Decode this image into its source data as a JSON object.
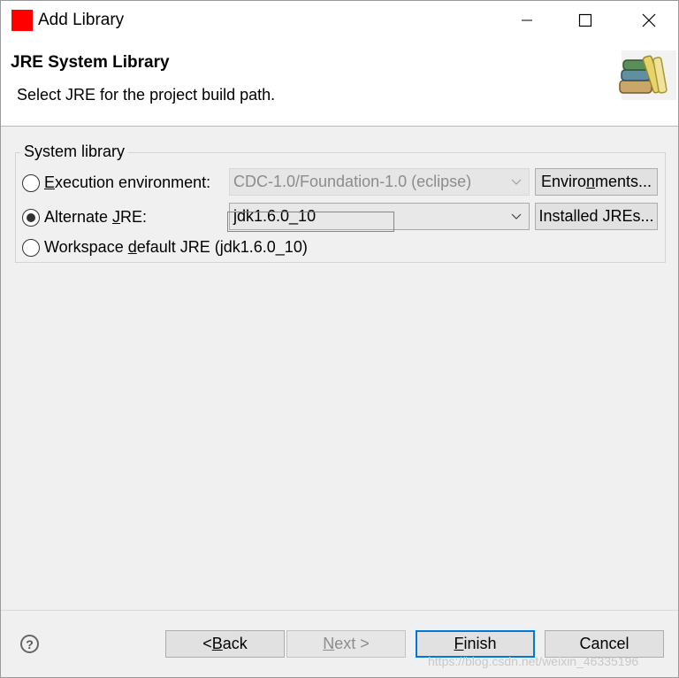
{
  "window": {
    "title": "Add Library"
  },
  "banner": {
    "title": "JRE System Library",
    "description": "Select JRE for the project build path.",
    "icon": "library-books-icon"
  },
  "group": {
    "label": "System library",
    "options": [
      {
        "label_before": "",
        "label_mnemonic": "E",
        "label_after": "xecution environment:",
        "checked": false,
        "combo_value": "CDC-1.0/Foundation-1.0 (eclipse)",
        "combo_enabled": false,
        "button_label_before": "Enviro",
        "button_label_mnemonic": "n",
        "button_label_after": "ments..."
      },
      {
        "label_before": "Alternate ",
        "label_mnemonic": "J",
        "label_after": "RE:",
        "checked": true,
        "combo_value": "jdk1.6.0_10",
        "combo_enabled": true,
        "button_label_before": "Installed JREs...",
        "button_label_mnemonic": "",
        "button_label_after": ""
      },
      {
        "label_before": "Workspace ",
        "label_mnemonic": "d",
        "label_after": "efault JRE (jdk1.6.0_10)",
        "checked": false
      }
    ]
  },
  "footer": {
    "help_label": "?",
    "back": {
      "before": "< ",
      "mnemonic": "B",
      "after": "ack",
      "enabled": true
    },
    "next": {
      "before": "",
      "mnemonic": "N",
      "after": "ext >",
      "enabled": false
    },
    "finish": {
      "before": "",
      "mnemonic": "F",
      "after": "inish",
      "enabled": true,
      "default": true
    },
    "cancel": {
      "label": "Cancel",
      "enabled": true
    }
  },
  "watermark": "https://blog.csdn.net/weixin_46335196"
}
